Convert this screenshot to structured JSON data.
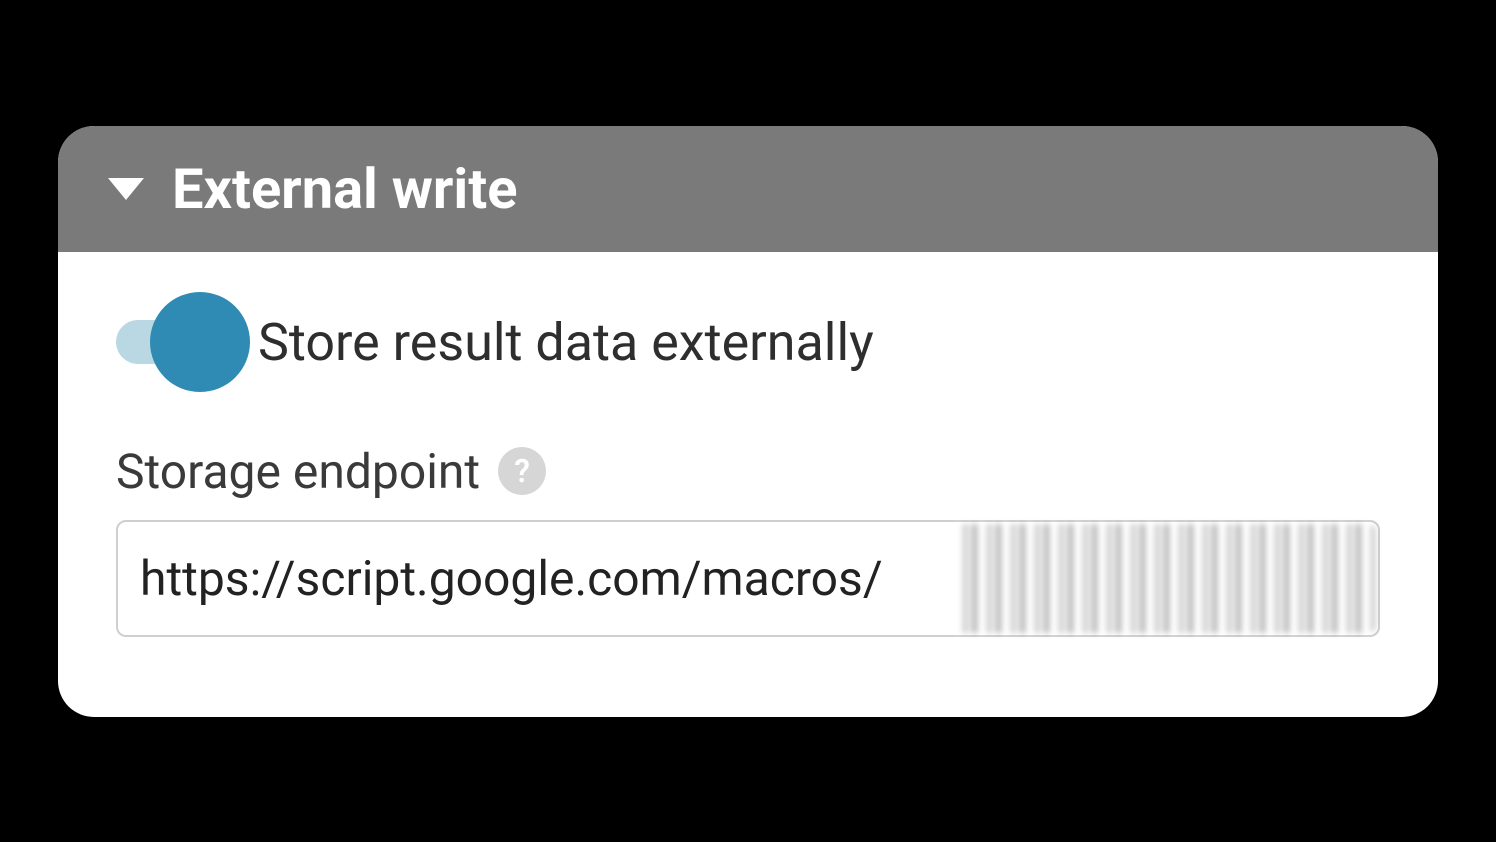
{
  "panel": {
    "title": "External write",
    "toggle": {
      "label": "Store result data externally",
      "enabled": true
    },
    "endpoint": {
      "label": "Storage endpoint",
      "help_symbol": "?",
      "value": "https://script.google.com/macros/"
    }
  }
}
